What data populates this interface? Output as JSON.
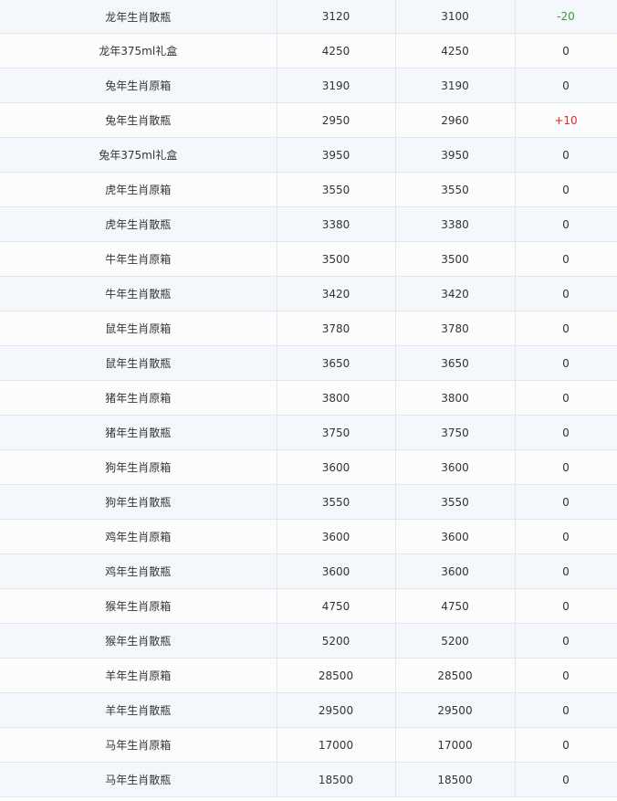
{
  "colors": {
    "row_alt": "#f4f8fd",
    "row_base": "#fcfcfc",
    "border": "#e3e7ec",
    "decrease": "#3a9a3a",
    "increase": "#e8261c",
    "text": "#333333"
  },
  "rows": [
    {
      "name": "龙年生肖散瓶",
      "prev": "3120",
      "curr": "3100",
      "diff": "-20",
      "trend": "down"
    },
    {
      "name": "龙年375ml礼盒",
      "prev": "4250",
      "curr": "4250",
      "diff": "0",
      "trend": "flat"
    },
    {
      "name": "兔年生肖原箱",
      "prev": "3190",
      "curr": "3190",
      "diff": "0",
      "trend": "flat"
    },
    {
      "name": "兔年生肖散瓶",
      "prev": "2950",
      "curr": "2960",
      "diff": "+10",
      "trend": "up"
    },
    {
      "name": "兔年375ml礼盒",
      "prev": "3950",
      "curr": "3950",
      "diff": "0",
      "trend": "flat"
    },
    {
      "name": "虎年生肖原箱",
      "prev": "3550",
      "curr": "3550",
      "diff": "0",
      "trend": "flat"
    },
    {
      "name": "虎年生肖散瓶",
      "prev": "3380",
      "curr": "3380",
      "diff": "0",
      "trend": "flat"
    },
    {
      "name": "牛年生肖原箱",
      "prev": "3500",
      "curr": "3500",
      "diff": "0",
      "trend": "flat"
    },
    {
      "name": "牛年生肖散瓶",
      "prev": "3420",
      "curr": "3420",
      "diff": "0",
      "trend": "flat"
    },
    {
      "name": "鼠年生肖原箱",
      "prev": "3780",
      "curr": "3780",
      "diff": "0",
      "trend": "flat"
    },
    {
      "name": "鼠年生肖散瓶",
      "prev": "3650",
      "curr": "3650",
      "diff": "0",
      "trend": "flat"
    },
    {
      "name": "猪年生肖原箱",
      "prev": "3800",
      "curr": "3800",
      "diff": "0",
      "trend": "flat"
    },
    {
      "name": "猪年生肖散瓶",
      "prev": "3750",
      "curr": "3750",
      "diff": "0",
      "trend": "flat"
    },
    {
      "name": "狗年生肖原箱",
      "prev": "3600",
      "curr": "3600",
      "diff": "0",
      "trend": "flat"
    },
    {
      "name": "狗年生肖散瓶",
      "prev": "3550",
      "curr": "3550",
      "diff": "0",
      "trend": "flat"
    },
    {
      "name": "鸡年生肖原箱",
      "prev": "3600",
      "curr": "3600",
      "diff": "0",
      "trend": "flat"
    },
    {
      "name": "鸡年生肖散瓶",
      "prev": "3600",
      "curr": "3600",
      "diff": "0",
      "trend": "flat"
    },
    {
      "name": "猴年生肖原箱",
      "prev": "4750",
      "curr": "4750",
      "diff": "0",
      "trend": "flat"
    },
    {
      "name": "猴年生肖散瓶",
      "prev": "5200",
      "curr": "5200",
      "diff": "0",
      "trend": "flat"
    },
    {
      "name": "羊年生肖原箱",
      "prev": "28500",
      "curr": "28500",
      "diff": "0",
      "trend": "flat"
    },
    {
      "name": "羊年生肖散瓶",
      "prev": "29500",
      "curr": "29500",
      "diff": "0",
      "trend": "flat"
    },
    {
      "name": "马年生肖原箱",
      "prev": "17000",
      "curr": "17000",
      "diff": "0",
      "trend": "flat"
    },
    {
      "name": "马年生肖散瓶",
      "prev": "18500",
      "curr": "18500",
      "diff": "0",
      "trend": "flat"
    }
  ]
}
